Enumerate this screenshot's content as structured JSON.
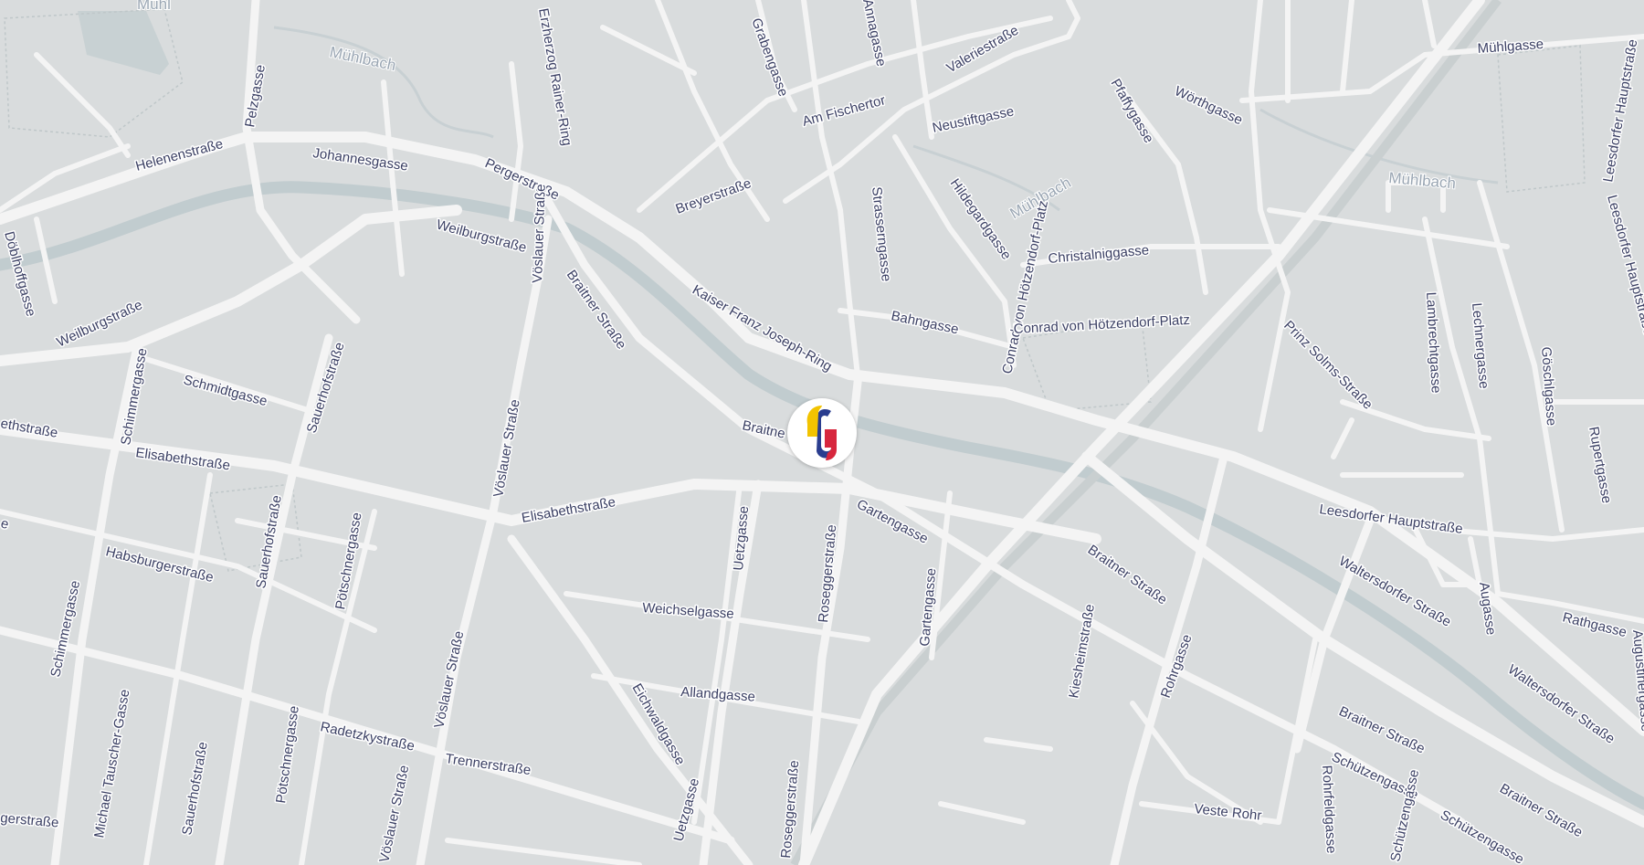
{
  "water": {
    "river_name": "Mühlbach"
  },
  "streets": [
    "Helenenstraße",
    "Johannesgasse",
    "Pergerstraße",
    "Weilburgstraße",
    "Weilburgstraße",
    "Pelzgasse",
    "Herzog Rainer-Ring",
    "Grabengasse",
    "Annagasse",
    "Valeriestraße",
    "Am Fischertor",
    "Neustiftgasse",
    "Breyerstraße",
    "Pfaffygasse",
    "Wörthgasse",
    "Mühlgasse",
    "Strasserngasse",
    "Hildegardgasse",
    "Christalniggasse",
    "Bahngasse",
    "Conrad von Hötzendorf-Platz",
    "Kaiser Franz Joseph-Ring",
    "Braitner Straße",
    "Braitner Straße",
    "Vöslauer Straße",
    "Vöslauer Straße",
    "Döblhoffgasse",
    "Schimmergasse",
    "Schmidtgasse",
    "Sauerhofstraße",
    "Elisabethstraße",
    "Elisabethstraße",
    "Elisabethstraße",
    "Habsburgerstraße",
    "Sauerhofstraße",
    "Pötschnergasse",
    "Uetzgasse",
    "Roseggerstraße",
    "Gartengasse",
    "Gartengasse",
    "Weichselgasse",
    "Allandgasse",
    "Eichwaldgasse",
    "Uetzgasse",
    "Roseggerstraße",
    "Schimmergasse",
    "Michael Tauscher-Gasse",
    "Sauerhofstraße",
    "Pötschnergasse",
    "Radetzkystraße",
    "Trennerstraße",
    "Vöslauer Straße",
    "Braitner Straße",
    "Kiesheimstraße",
    "Rohrgasse",
    "Veste Rohr",
    "Rohrfeldgasse",
    "Prinz Solms-Straße",
    "Lambrechtgasse",
    "Lechnergasse",
    "Göschlgasse",
    "Rupertgasse",
    "Leesdorfer Hauptstraße",
    "Waltersdorfer Straße",
    "Augasse",
    "Rathgasse",
    "Waltersdorfer Straße",
    "Braitner Straße",
    "Schützengasse",
    "Schützengasse",
    "Braitner Straße",
    "Augustinergasse",
    "Leesdorfer Hauptstraße",
    "Leesdorfer Hauptstraße",
    "Schützengasse",
    "Erzherzog Rainer-Ring",
    "Mühlbach"
  ],
  "partial_labels": [
    "Mühl",
    "ethstraße",
    "e",
    "Braitne",
    "gerstraße"
  ],
  "marker": {
    "name": "location-marker",
    "colors": {
      "yellow": "#f2c300",
      "blue": "#2a3d8f",
      "red": "#d7263d"
    }
  },
  "colors": {
    "land": "#d9dcdd",
    "road": "#f4f4f4",
    "water": "#c1cccf",
    "label": "#3a3f63"
  }
}
